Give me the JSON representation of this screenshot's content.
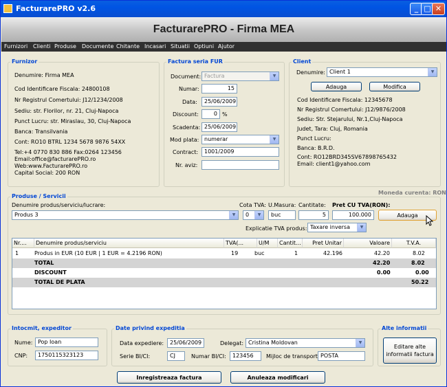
{
  "window": {
    "title": "FacturarePRO v2.6",
    "min": "_",
    "max": "□",
    "close": "✕"
  },
  "banner": {
    "title": "FacturarePRO - Firma MEA"
  },
  "menu": [
    "Furnizori",
    "Clienti",
    "Produse",
    "Documente",
    "Chitante",
    "Incasari",
    "Situatii",
    "Optiuni",
    "Ajutor"
  ],
  "furnizor": {
    "title": "Furnizor",
    "lines": [
      "Denumire:  Firma MEA",
      "Cod Identificare Fiscala:  24800108",
      "Nr Registrul Comertului:  J12/1234/2008",
      "Sediu: str. Florilor, nr. 21, Cluj-Napoca",
      "Punct Lucru: str. Miraslau, 30, Cluj-Napoca",
      "Banca:  Transilvania",
      "Cont:  RO10 BTRL 1234 5678 9876 54XX",
      "Tel:+4 0770 830 886  Fax:0264 123456",
      "Email:office@facturarePRO.ro",
      "Web:www.FacturarePRO.ro",
      "Capital Social: 200 RON"
    ]
  },
  "factura": {
    "title": "Factura seria FUR",
    "document_label": "Document:",
    "document_value": "Factura",
    "numar_label": "Numar:",
    "numar_value": "15",
    "data_label": "Data:",
    "data_value": "25/06/2009",
    "discount_label": "Discount:",
    "discount_value": "0",
    "discount_unit": "%",
    "scadenta_label": "Scadenta:",
    "scadenta_value": "25/06/2009",
    "mod_plata_label": "Mod plata:",
    "mod_plata_value": "numerar",
    "contract_label": "Contract:",
    "contract_value": "1001/2009",
    "nr_aviz_label": "Nr. aviz:",
    "nr_aviz_value": ""
  },
  "client": {
    "title": "Client",
    "denumire_label": "Denumire:",
    "denumire_value": "Client 1",
    "add_label": "Adauga",
    "edit_label": "Modifica",
    "lines": [
      "Cod Identificare Fiscala:  12345678",
      "Nr Registrul Comertului:  J12/9876/2008",
      "Sediu: Str. Stejarului, Nr.1,Cluj-Napoca",
      "Judet, Tara: Cluj, Romania",
      "Punct Lucru:",
      "Banca:  B.R.D.",
      "Cont:  RO12BRD345SV67898765432",
      "Email: client1@yahoo.com"
    ]
  },
  "moneda": "Moneda curenta: RON",
  "produse": {
    "title": "Produse / Servicii",
    "denumire_label": "Denumire produs/serviciu/lucrare:",
    "denumire_value": "Produs 3",
    "cota_label": "Cota TVA:",
    "cota_value": "0",
    "um_label": "U.Masura:",
    "um_value": "buc",
    "cant_label": "Cantitate:",
    "cant_value": "5",
    "pret_label": "Pret CU TVA(RON):",
    "pret_value": "100.000",
    "add_label": "Adauga",
    "expl_label": "Explicatie TVA produs:",
    "expl_value": "Taxare inversa"
  },
  "table": {
    "headers": [
      "Nr....",
      "Denumire produs/serviciu",
      "TVA(...",
      "U/M",
      "Cantit...",
      "Pret Unitar",
      "Valoare",
      "T.V.A."
    ],
    "rows": [
      {
        "nr": "1",
        "den": "Produs in EUR (10 EUR | 1 EUR = 4.2196 RON)",
        "tva": "19",
        "um": "buc",
        "cant": "1",
        "pret": "42.196",
        "val": "42.20",
        "tvaval": "8.02"
      }
    ],
    "total": {
      "label": "TOTAL",
      "val": "42.20",
      "tva": "8.02"
    },
    "discount": {
      "label": "DISCOUNT",
      "val": "0.00",
      "tva": "0.00"
    },
    "total_plata": {
      "label": "TOTAL DE PLATA",
      "tva": "50.22"
    }
  },
  "intocmit": {
    "title": "Intocmit, expeditor",
    "nume_label": "Nume:",
    "nume_value": "Pop Ioan",
    "cnp_label": "CNP:",
    "cnp_value": "1750115323123"
  },
  "expeditie": {
    "title": "Date privind expeditia",
    "data_label": "Data expediere:",
    "data_value": "25/06/2009",
    "delegat_label": "Delegat:",
    "delegat_value": "Cristina Moldovan",
    "serie_label": "Serie BI/CI:",
    "serie_value": "CJ",
    "numar_label": "Numar BI/CI:",
    "numar_value": "123456",
    "mijloc_label": "Mijloc de transport:",
    "mijloc_value": "POSTA"
  },
  "alte": {
    "title": "Alte informatii",
    "btn1": "Editare alte",
    "btn2": "informatii factura"
  },
  "footer": {
    "save": "Inregistreaza factura",
    "cancel": "Anuleaza modificari"
  }
}
